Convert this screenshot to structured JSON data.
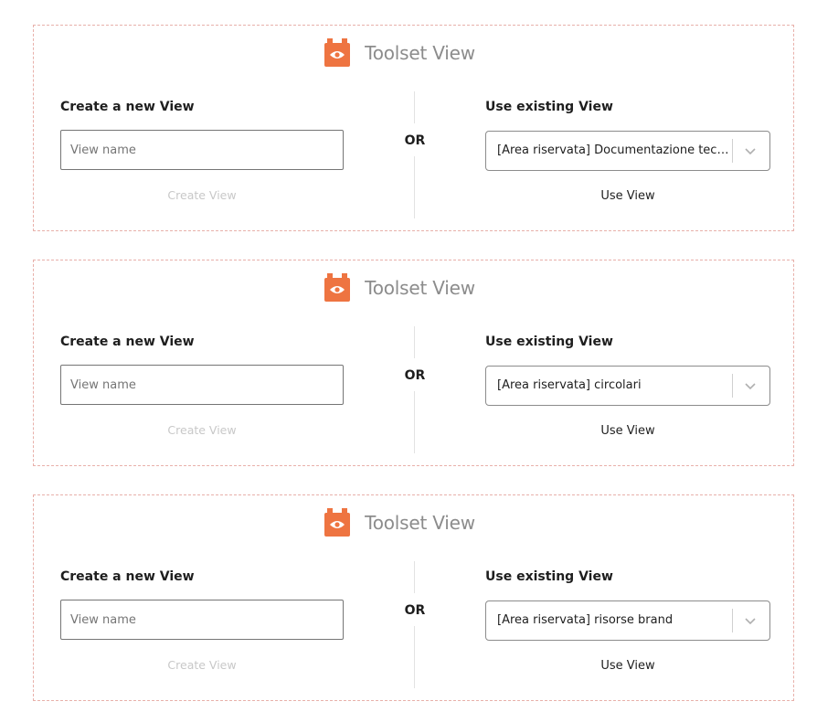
{
  "theme": {
    "block_border": "#e8b0aa",
    "icon_color": "#ee7441",
    "title_color": "#8c8c8c",
    "disabled_text": "#c8c8c8"
  },
  "blocks": [
    {
      "icon": "toolset-view-icon",
      "title": "Toolset View",
      "create_label": "Create a new View",
      "name_placeholder": "View name",
      "name_value": "",
      "create_button": "Create View",
      "or_label": "OR",
      "existing_label": "Use existing View",
      "selected_view": "[Area riservata] Documentazione tecnica",
      "use_button": "Use View"
    },
    {
      "icon": "toolset-view-icon",
      "title": "Toolset View",
      "create_label": "Create a new View",
      "name_placeholder": "View name",
      "name_value": "",
      "create_button": "Create View",
      "or_label": "OR",
      "existing_label": "Use existing View",
      "selected_view": "[Area riservata] circolari",
      "use_button": "Use View"
    },
    {
      "icon": "toolset-view-icon",
      "title": "Toolset View",
      "create_label": "Create a new View",
      "name_placeholder": "View name",
      "name_value": "",
      "create_button": "Create View",
      "or_label": "OR",
      "existing_label": "Use existing View",
      "selected_view": "[Area riservata] risorse brand",
      "use_button": "Use View"
    }
  ]
}
